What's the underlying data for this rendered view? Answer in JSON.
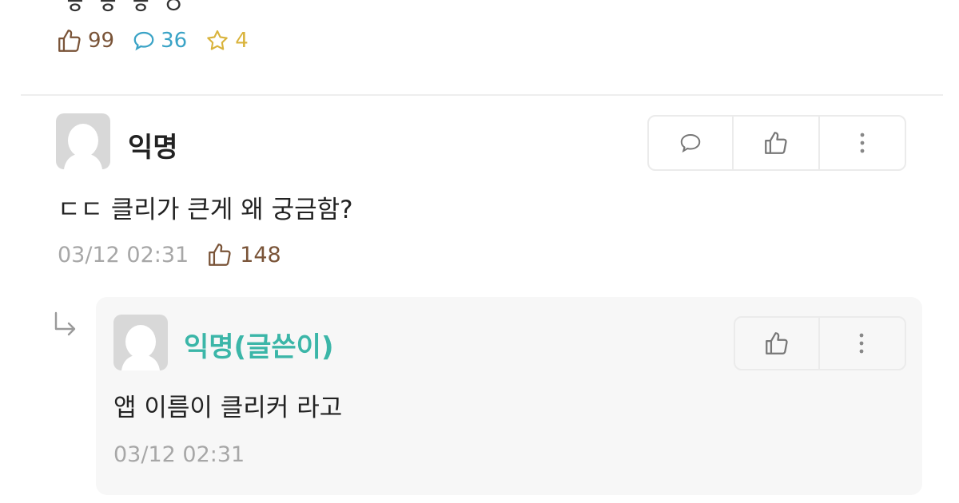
{
  "post": {
    "content_tail": "ㅎ ㅎ ㅎ ㅇ",
    "likes": "99",
    "comments": "36",
    "scraps": "4"
  },
  "comment": {
    "author": "익명",
    "text": "ㄷㄷ 클리가 큰게 왜 궁금함?",
    "time": "03/12 02:31",
    "likes": "148"
  },
  "reply": {
    "author": "익명(글쓴이)",
    "text": "앱 이름이 클리커 라고",
    "time": "03/12 02:31"
  },
  "icons": {
    "like": "thumbs-up-icon",
    "comment": "speech-bubble-icon",
    "scrap": "star-icon",
    "more": "more-vertical-icon",
    "reply": "reply-arrow-icon",
    "avatar": "default-avatar-icon"
  },
  "colors": {
    "like": "#7a5438",
    "comment": "#3aa3c6",
    "scrap": "#d9b33b",
    "op_author": "#3bb6a8",
    "meta": "#a7a7a7"
  }
}
